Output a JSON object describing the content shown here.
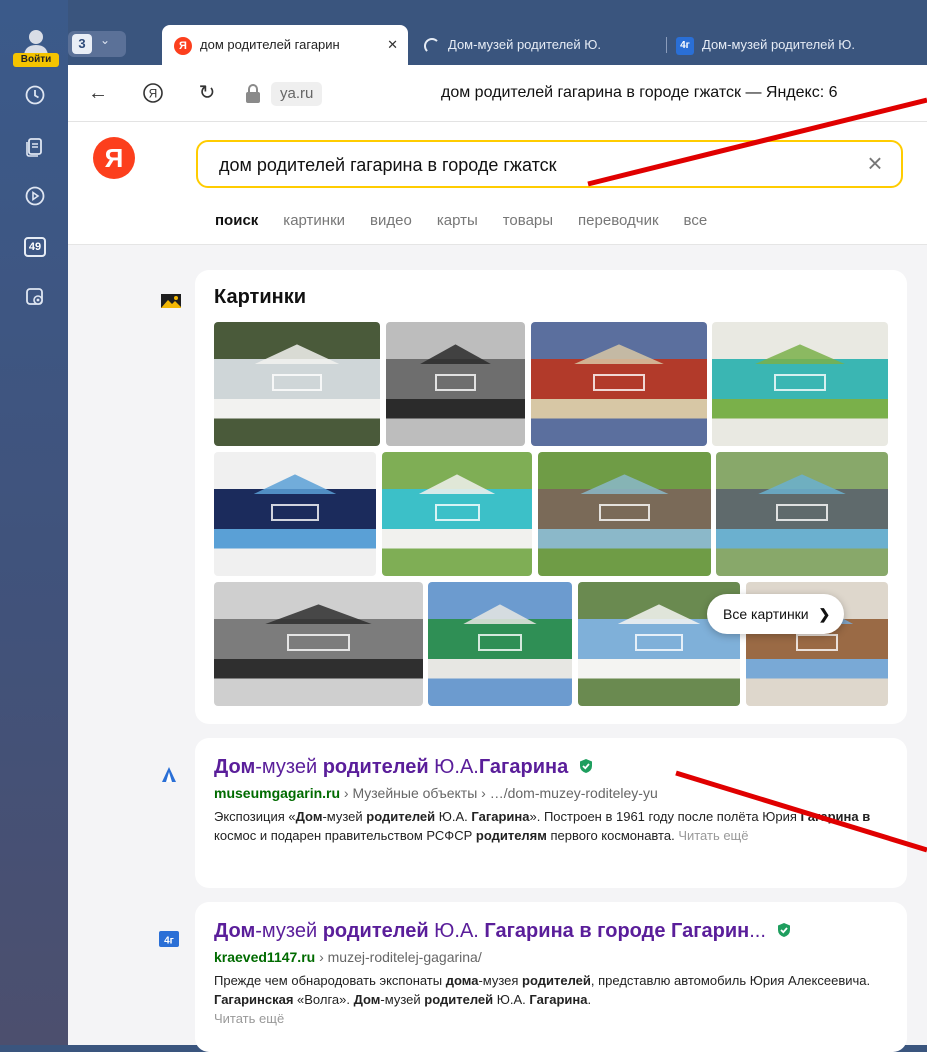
{
  "rail": {
    "login_label": "Войти",
    "counter_badge": "49",
    "icons": [
      "user-icon",
      "history-icon",
      "collections-icon",
      "video-icon",
      "counter-badge",
      "screenshot-icon"
    ]
  },
  "tabstrip": {
    "tabs_count": "3",
    "tabs": [
      {
        "title": "дом родителей гагарин",
        "favicon": "yandex-icon",
        "active": true
      },
      {
        "title": "Дом-музей родителей Ю.",
        "favicon": "loading-icon",
        "active": false
      },
      {
        "title": "Дом-музей родителей Ю.",
        "favicon": "kraeved-icon",
        "active": false
      }
    ]
  },
  "addressbar": {
    "url": "ya.ru",
    "page_title": "дом родителей гагарина в городе гжатск — Яндекс: 6"
  },
  "serp": {
    "logo": "Я",
    "query": "дом родителей гагарина в городе гжатск",
    "tabs": [
      "поиск",
      "картинки",
      "видео",
      "карты",
      "товары",
      "переводчик",
      "все"
    ],
    "images": {
      "title": "Картинки",
      "all_button": "Все картинки",
      "thumbs": [
        "white pavilion house with people",
        "old wooden house black and white",
        "room interior with carpet",
        "turquoise house with trees",
        "framed screen photo of house",
        "turquoise house with steps",
        "statue seated in front of house",
        "statue seated in front of house",
        "old wooden house black and white",
        "green house",
        "blue house with flowering tree",
        "wooden house with blue trim"
      ]
    },
    "results": [
      {
        "title_parts": [
          [
            "Дом",
            true
          ],
          [
            "-музей ",
            false
          ],
          [
            "родителей",
            true
          ],
          [
            " Ю.А.",
            false
          ],
          [
            "Гагарина",
            true
          ]
        ],
        "host": "museumgagarin.ru",
        "path": " › Музейные объекты › …/dom-muzey-roditeley-yu",
        "snippet_parts": [
          [
            "Экспозиция «",
            false
          ],
          [
            "Дом",
            true
          ],
          [
            "-музей ",
            false
          ],
          [
            "родителей",
            true
          ],
          [
            " Ю.А. ",
            false
          ],
          [
            "Гагарина",
            true
          ],
          [
            "». Построен в 1961 году после полёта Юрия ",
            false
          ],
          [
            "Гагарина в",
            true
          ],
          [
            " космос и подарен правительством РСФСР ",
            false
          ],
          [
            "родителям",
            true
          ],
          [
            " первого космонавта. ",
            false
          ]
        ],
        "more": "Читать ещё",
        "icon": "museum-icon"
      },
      {
        "title_parts": [
          [
            "Дом",
            true
          ],
          [
            "-музей ",
            false
          ],
          [
            "родителей",
            true
          ],
          [
            " Ю.А. ",
            false
          ],
          [
            "Гагарина в городе Гагарин",
            true
          ],
          [
            "...",
            false
          ]
        ],
        "host": "kraeved1147.ru",
        "path": " › muzej-roditelej-gagarina/",
        "snippet_parts": [
          [
            "Прежде чем обнародовать экспонаты ",
            false
          ],
          [
            "дома",
            true
          ],
          [
            "-музея ",
            false
          ],
          [
            "родителей",
            true
          ],
          [
            ", представлю автомобиль Юрия Алексеевича. ",
            false
          ],
          [
            "Гагаринская",
            true
          ],
          [
            " «Волга». ",
            false
          ],
          [
            "Дом",
            true
          ],
          [
            "-музей ",
            false
          ],
          [
            "родителей",
            true
          ],
          [
            " Ю.А. ",
            false
          ],
          [
            "Гагарина",
            true
          ],
          [
            ".",
            false
          ]
        ],
        "more": "Читать ещё",
        "icon": "kraeved-icon"
      }
    ]
  },
  "colors": {
    "accent_yellow": "#ffcc00",
    "yandex_red": "#fc3f1d",
    "title_purple": "#5a1e9a",
    "url_green": "#006b00",
    "verified_green": "#1e9e5e",
    "annotation_red": "#e00000"
  }
}
